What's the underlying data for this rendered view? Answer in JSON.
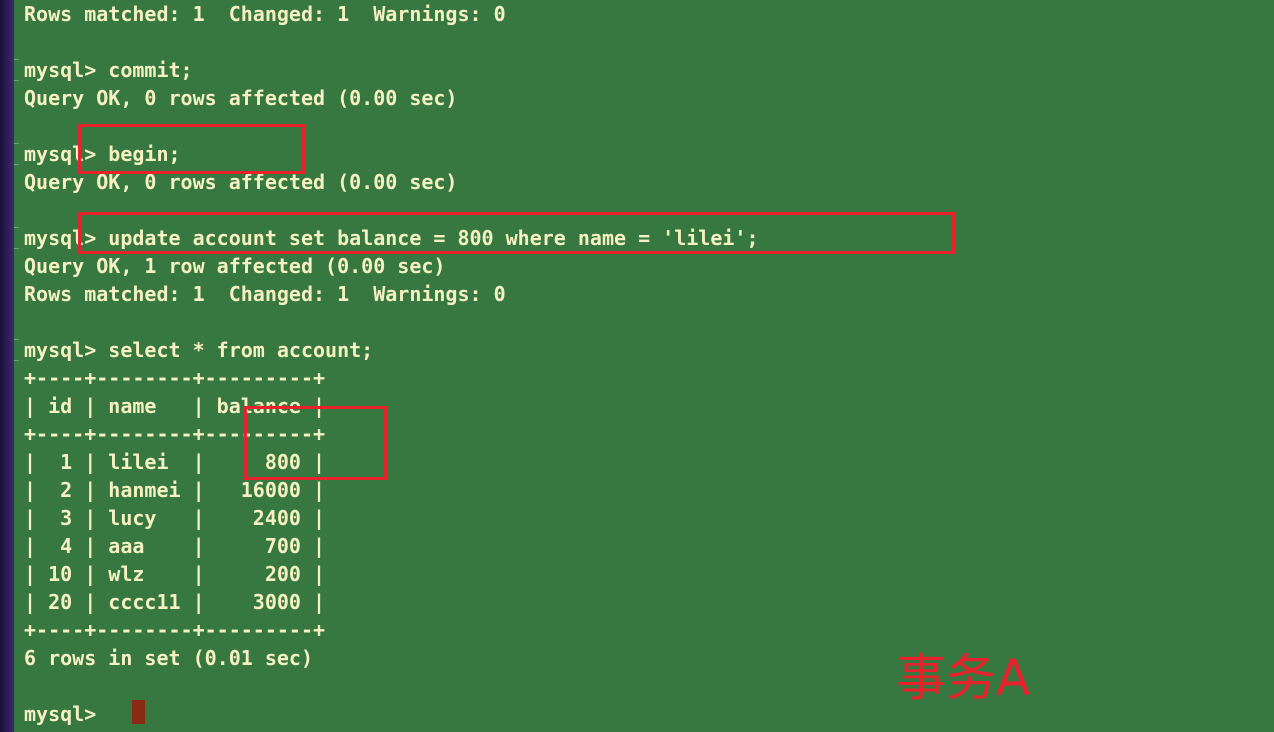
{
  "terminal": {
    "lines": [
      "Rows matched: 1  Changed: 1  Warnings: 0",
      "",
      "mysql> commit;",
      "Query OK, 0 rows affected (0.00 sec)",
      "",
      "mysql> begin;",
      "Query OK, 0 rows affected (0.00 sec)",
      "",
      "mysql> update account set balance = 800 where name = 'lilei';",
      "Query OK, 1 row affected (0.00 sec)",
      "Rows matched: 1  Changed: 1  Warnings: 0",
      "",
      "mysql> select * from account;",
      "+----+--------+---------+",
      "| id | name   | balance |",
      "+----+--------+---------+",
      "|  1 | lilei  |     800 |",
      "|  2 | hanmei |   16000 |",
      "|  3 | lucy   |    2400 |",
      "|  4 | aaa    |     700 |",
      "| 10 | wlz    |     200 |",
      "| 20 | cccc11 |    3000 |",
      "+----+--------+---------+",
      "6 rows in set (0.01 sec)",
      "",
      "mysql> "
    ]
  },
  "annotation": {
    "label": "事务A",
    "color": "#e8222c"
  },
  "colors": {
    "terminal_bg": "#377840",
    "text": "#f6f1c2",
    "cursor": "#8a2a14"
  }
}
